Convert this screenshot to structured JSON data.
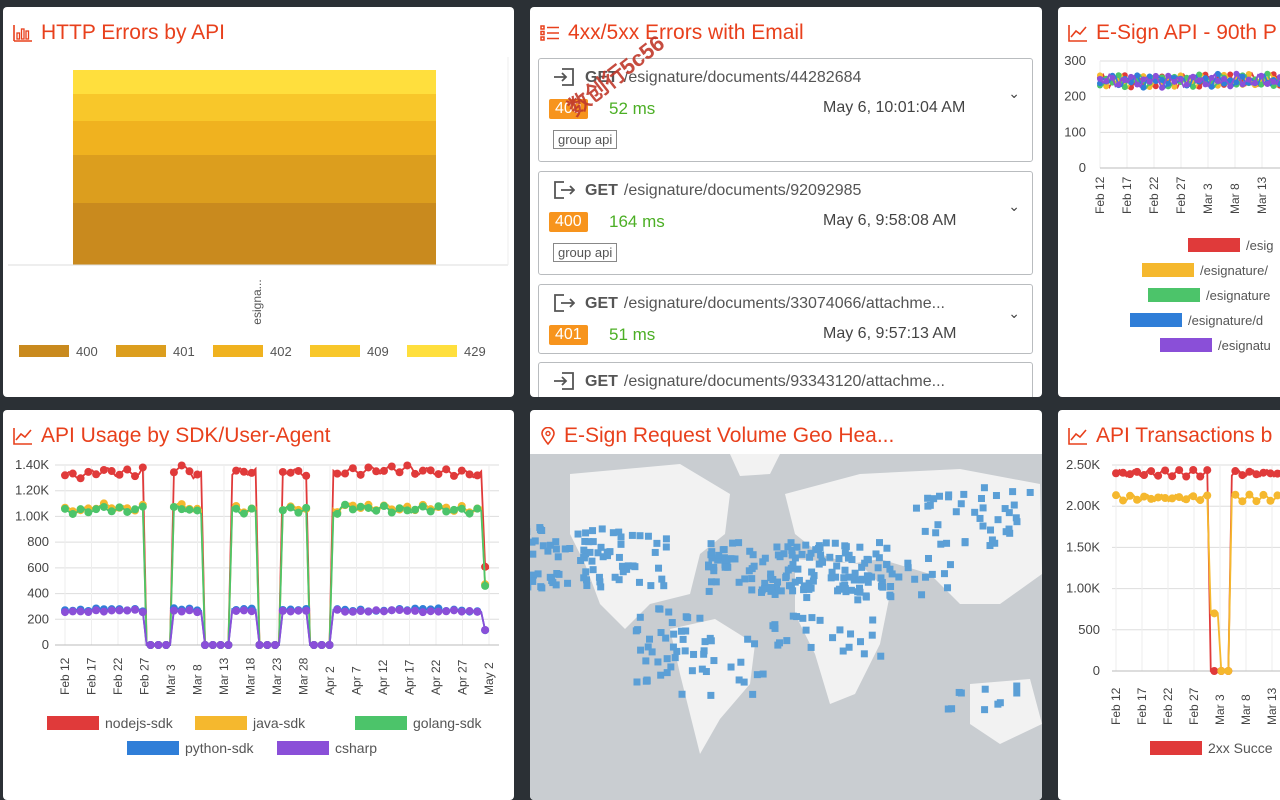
{
  "panels": {
    "http_errors": {
      "title": "HTTP Errors by API",
      "x_label": "esigna...",
      "legend": [
        "400",
        "401",
        "402",
        "409",
        "429"
      ],
      "colors": [
        "#c98a1e",
        "#dc9e1e",
        "#f0b21f",
        "#f8c72a",
        "#ffdf3d"
      ]
    },
    "errors_email": {
      "title": "4xx/5xx Errors with Email",
      "items": [
        {
          "method": "GET",
          "path": "/esignature/documents/44282684",
          "status": "400",
          "duration": "52 ms",
          "time": "May 6, 10:01:04 AM",
          "tag": "group api"
        },
        {
          "method": "GET",
          "path": "/esignature/documents/92092985",
          "status": "400",
          "duration": "164 ms",
          "time": "May 6, 9:58:08 AM",
          "tag": "group api"
        },
        {
          "method": "GET",
          "path": "/esignature/documents/33074066/attachme...",
          "status": "401",
          "duration": "51 ms",
          "time": "May 6, 9:57:13 AM",
          "tag": ""
        },
        {
          "method": "GET",
          "path": "/esignature/documents/93343120/attachme...",
          "status": "",
          "duration": "",
          "time": "",
          "tag": ""
        }
      ],
      "watermark": "数创行5c56"
    },
    "esign_api": {
      "title": "E-Sign API - 90th P",
      "legend": [
        "/esig",
        "/esignature/",
        "/esignature",
        "/esignature/d",
        "/esignatu"
      ],
      "legend_colors": [
        "#e03a3a",
        "#f5b82e",
        "#4cc46a",
        "#2f7ed8",
        "#8a4fd8"
      ]
    },
    "sdk_usage": {
      "title": "API Usage by SDK/User-Agent"
    },
    "geo": {
      "title": "E-Sign Request Volume Geo Hea..."
    },
    "transactions": {
      "title": "API Transactions b",
      "legend": [
        "2xx Succe"
      ]
    }
  },
  "chart_data": [
    {
      "type": "bar",
      "stacked": true,
      "categories": [
        "esigna..."
      ],
      "series": [
        {
          "name": "400",
          "values": [
            310
          ]
        },
        {
          "name": "401",
          "values": [
            240
          ]
        },
        {
          "name": "402",
          "values": [
            170
          ]
        },
        {
          "name": "409",
          "values": [
            135
          ]
        },
        {
          "name": "429",
          "values": [
            120
          ]
        }
      ],
      "legend_position": "bottom"
    },
    {
      "type": "line",
      "x": [
        "Feb 12",
        "Feb 17",
        "Feb 22",
        "Feb 27",
        "Mar 3",
        "Mar 8",
        "Mar 13"
      ],
      "yticks": [
        0,
        100,
        200,
        300
      ],
      "ylim": [
        0,
        300
      ],
      "series_values": [
        255,
        250,
        260,
        245,
        255,
        250,
        258
      ]
    },
    {
      "type": "line",
      "x": [
        "Feb 12",
        "Feb 17",
        "Feb 22",
        "Feb 27",
        "Mar 3",
        "Mar 8",
        "Mar 13",
        "Mar 18",
        "Mar 23",
        "Mar 28",
        "Apr 2",
        "Apr 7",
        "Apr 12",
        "Apr 17",
        "Apr 22",
        "Apr 27",
        "May 2"
      ],
      "yticks": [
        "0",
        "200",
        "400",
        "600",
        "800",
        "1.00K",
        "1.20K",
        "1.40K"
      ],
      "ylim": [
        0,
        1400
      ],
      "series": [
        {
          "name": "nodejs-sdk",
          "color": "#e03a3a",
          "values": [
            1320,
            1350,
            1340,
            1360,
            1370,
            1320,
            1340,
            1350,
            1360,
            1340,
            1330,
            1350,
            1360,
            1370,
            1350,
            1340,
            1330
          ]
        },
        {
          "name": "java-sdk",
          "color": "#f5b82e",
          "values": [
            1050,
            1080,
            1060,
            1070,
            1080,
            1040,
            1060,
            1050,
            1070,
            1060,
            1050,
            1080,
            1070,
            1060,
            1070,
            1060,
            1050
          ]
        },
        {
          "name": "golang-sdk",
          "color": "#4cc46a",
          "values": [
            1040,
            1060,
            1050,
            1070,
            1060,
            1030,
            1050,
            1040,
            1060,
            1050,
            1040,
            1070,
            1060,
            1050,
            1060,
            1050,
            1040
          ]
        },
        {
          "name": "python-sdk",
          "color": "#2f7ed8",
          "values": [
            270,
            280,
            275,
            265,
            280,
            270,
            275,
            280,
            270,
            275,
            280,
            270,
            265,
            275,
            280,
            270,
            260
          ]
        },
        {
          "name": "csharp",
          "color": "#8a4fd8",
          "values": [
            260,
            265,
            270,
            260,
            265,
            260,
            270,
            265,
            260,
            265,
            270,
            260,
            265,
            270,
            260,
            265,
            260
          ]
        }
      ],
      "dips": [
        "Mar 3",
        "Mar 13",
        "Mar 23"
      ]
    },
    {
      "type": "line",
      "x": [
        "Feb 12",
        "Feb 17",
        "Feb 22",
        "Feb 27",
        "Mar 3",
        "Mar 8",
        "Mar 13"
      ],
      "yticks": [
        "0",
        "500",
        "1.00K",
        "1.50K",
        "2.00K",
        "2.50K"
      ],
      "ylim": [
        0,
        2500
      ],
      "series": [
        {
          "name": "2xx Succe",
          "color": "#e03a3a",
          "values": [
            2400,
            2420,
            2410,
            2430,
            0,
            2420,
            0
          ]
        },
        {
          "name": "",
          "color": "#f5b82e",
          "values": [
            2100,
            2130,
            2120,
            2150,
            700,
            2150,
            0
          ]
        }
      ]
    }
  ]
}
